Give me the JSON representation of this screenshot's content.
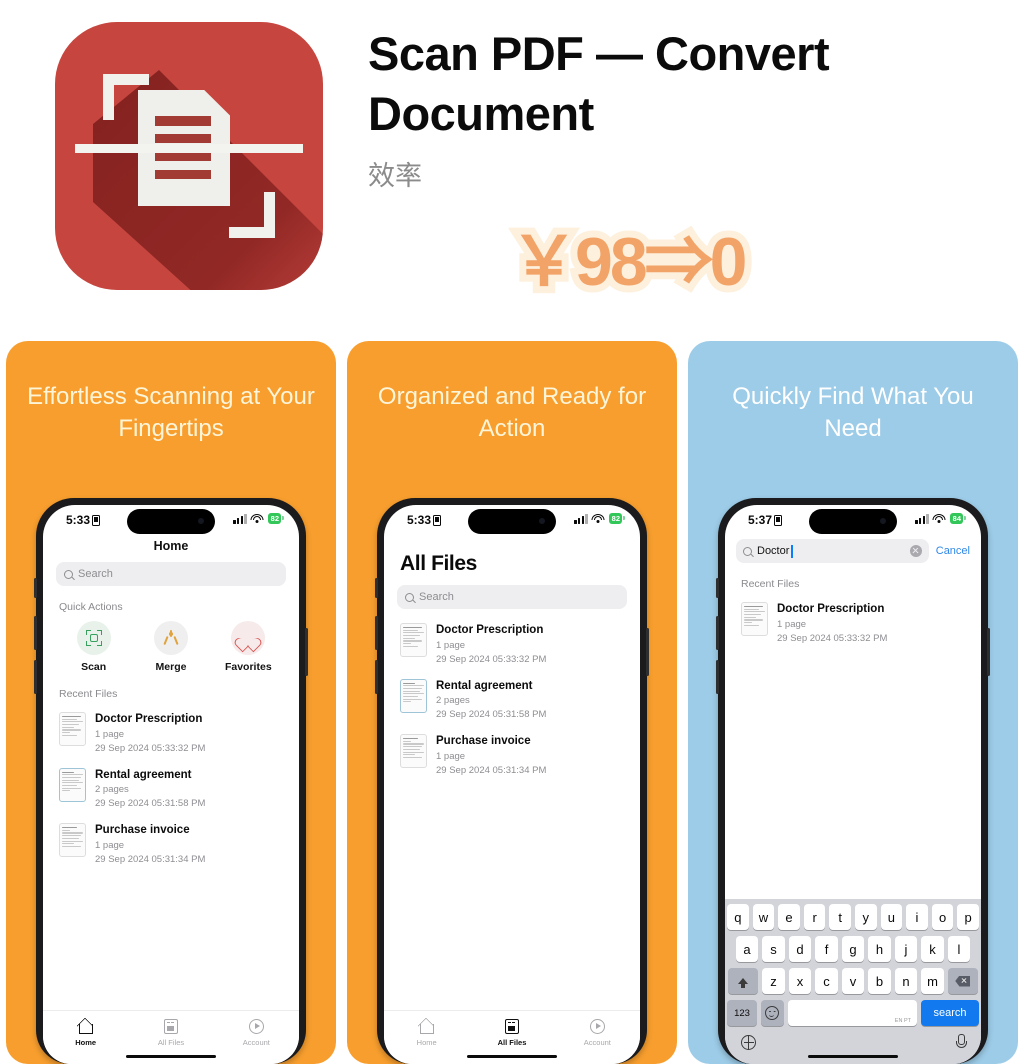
{
  "header": {
    "app_title": "Scan PDF — Convert Document",
    "category": "效率",
    "price_promo": "￥98⇒0",
    "icon_name": "scan-document-app-icon"
  },
  "panels": [
    {
      "id": "panel-1",
      "caption": "Effortless Scanning at Your Fingertips",
      "bg_color": "#F79E2E",
      "phone": {
        "status": {
          "time": "5:33",
          "battery": "82"
        },
        "nav_title": "Home",
        "search_placeholder": "Search",
        "quick_actions_label": "Quick Actions",
        "quick_actions": [
          {
            "label": "Scan",
            "icon": "scan-icon",
            "color": "#37A05E"
          },
          {
            "label": "Merge",
            "icon": "merge-icon",
            "color": "#E0A33E"
          },
          {
            "label": "Favorites",
            "icon": "heart-icon",
            "color": "#D9534F"
          }
        ],
        "recent_label": "Recent Files",
        "files": [
          {
            "name": "Doctor Prescription",
            "pages": "1 page",
            "date": "29 Sep 2024 05:33:32 PM"
          },
          {
            "name": "Rental agreement",
            "pages": "2 pages",
            "date": "29 Sep 2024 05:31:58 PM"
          },
          {
            "name": "Purchase invoice",
            "pages": "1 page",
            "date": "29 Sep 2024 05:31:34 PM"
          }
        ],
        "tabs": [
          {
            "label": "Home",
            "icon": "home-icon",
            "active": true
          },
          {
            "label": "All Files",
            "icon": "files-icon",
            "active": false
          },
          {
            "label": "Account",
            "icon": "account-icon",
            "active": false
          }
        ]
      }
    },
    {
      "id": "panel-2",
      "caption": "Organized and Ready for Action",
      "bg_color": "#F79E2E",
      "phone": {
        "status": {
          "time": "5:33",
          "battery": "82"
        },
        "large_title": "All Files",
        "search_placeholder": "Search",
        "files": [
          {
            "name": "Doctor Prescription",
            "pages": "1 page",
            "date": "29 Sep 2024 05:33:32 PM"
          },
          {
            "name": "Rental agreement",
            "pages": "2 pages",
            "date": "29 Sep 2024 05:31:58 PM"
          },
          {
            "name": "Purchase invoice",
            "pages": "1 page",
            "date": "29 Sep 2024 05:31:34 PM"
          }
        ],
        "tabs": [
          {
            "label": "Home",
            "icon": "home-icon",
            "active": false
          },
          {
            "label": "All Files",
            "icon": "files-icon",
            "active": true
          },
          {
            "label": "Account",
            "icon": "account-icon",
            "active": false
          }
        ]
      }
    },
    {
      "id": "panel-3",
      "caption": "Quickly Find What You Need",
      "bg_color": "#9DCCE8",
      "phone": {
        "status": {
          "time": "5:37",
          "battery": "84"
        },
        "search_value": "Doctor",
        "cancel_label": "Cancel",
        "recent_label": "Recent Files",
        "files": [
          {
            "name": "Doctor Prescription",
            "pages": "1 page",
            "date": "29 Sep 2024 05:33:32 PM"
          }
        ],
        "keyboard": {
          "row1": [
            "q",
            "w",
            "e",
            "r",
            "t",
            "y",
            "u",
            "i",
            "o",
            "p"
          ],
          "row2": [
            "a",
            "s",
            "d",
            "f",
            "g",
            "h",
            "j",
            "k",
            "l"
          ],
          "row3": [
            "z",
            "x",
            "c",
            "v",
            "b",
            "n",
            "m"
          ],
          "shift_key": "shift-icon",
          "delete_key": "delete-icon",
          "numbers_key": "123",
          "emoji_key": "emoji-icon",
          "space_hint": "EN PT",
          "return_key": "search",
          "globe_key": "globe-icon",
          "dictation_key": "microphone-icon"
        }
      }
    }
  ]
}
